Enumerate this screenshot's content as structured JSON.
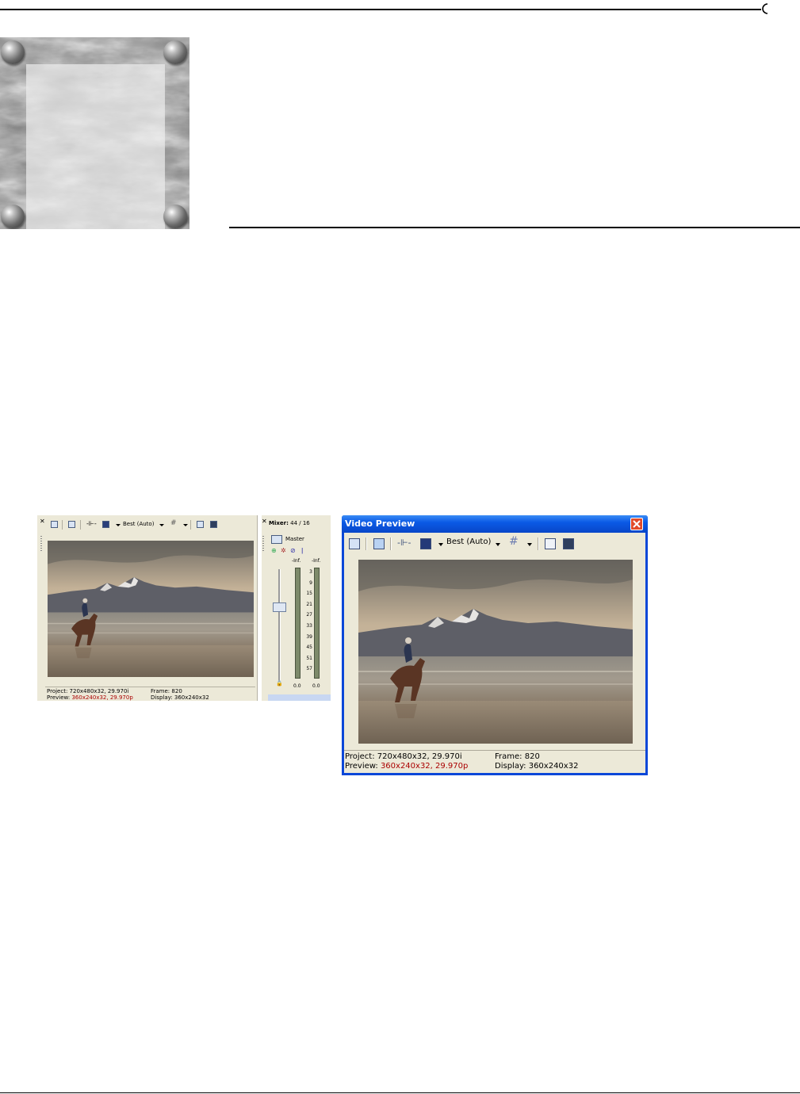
{
  "docked_window": {
    "toolbar": {
      "quality_label": "Best (Auto)"
    },
    "status": {
      "project_label": "Project:",
      "project_value": "720x480x32, 29.970i",
      "preview_label": "Preview:",
      "preview_value": "360x240x32, 29.970p",
      "frame_label": "Frame:",
      "frame_value": "820",
      "display_label": "Display:",
      "display_value": "360x240x32"
    },
    "mixer": {
      "title": "Mixer:",
      "title_value": "44 / 16",
      "master_label": "Master",
      "peak_left": "-Inf.",
      "peak_right": "-Inf.",
      "scale": [
        "3",
        "9",
        "15",
        "21",
        "27",
        "33",
        "39",
        "45",
        "51",
        "57"
      ],
      "level_left": "0.0",
      "level_right": "0.0"
    }
  },
  "video_preview_window": {
    "title": "Video Preview",
    "toolbar": {
      "quality_label": "Best (Auto)"
    },
    "status": {
      "project_label": "Project:",
      "project_value": "720x480x32, 29.970i",
      "preview_label": "Preview:",
      "preview_value": "360x240x32, 29.970p",
      "frame_label": "Frame:",
      "frame_value": "820",
      "display_label": "Display:",
      "display_value": "360x240x32"
    }
  },
  "colors": {
    "window_bg": "#ece9d8",
    "titlebar_blue": "#0b5ae6",
    "preview_red": "#aa0000"
  }
}
